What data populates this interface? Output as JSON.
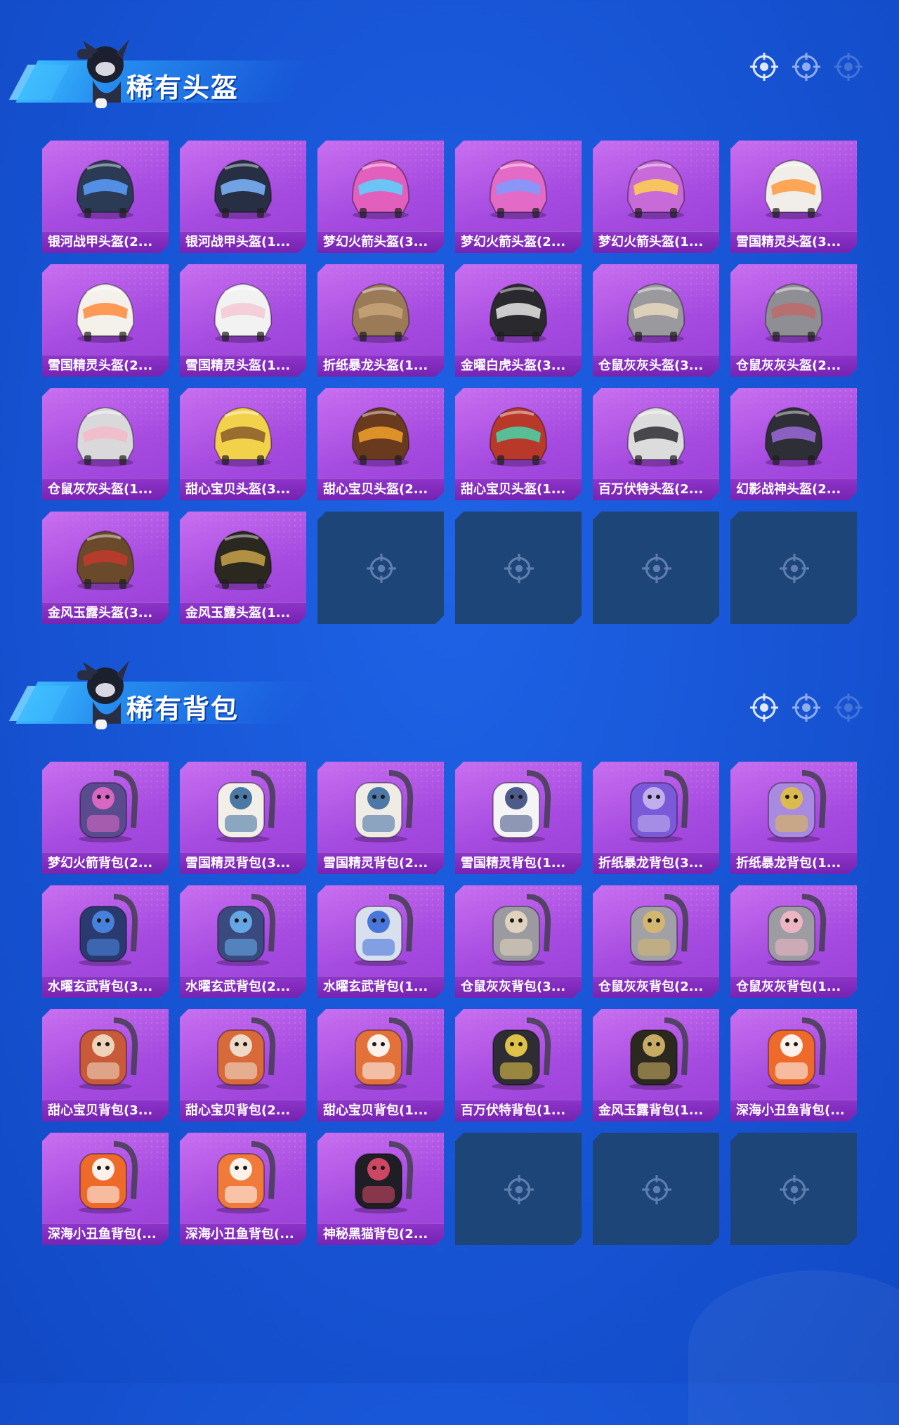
{
  "sections": [
    {
      "title": "稀有头盔",
      "items": [
        {
          "label": "银河战甲头盔(2...",
          "icon": "helmet-icon",
          "color": "#2b3a55",
          "accent": "#5aa0ff"
        },
        {
          "label": "银河战甲头盔(1...",
          "icon": "helmet-icon",
          "color": "#262f44",
          "accent": "#7fb6ff"
        },
        {
          "label": "梦幻火箭头盔(3...",
          "icon": "helmet-icon",
          "color": "#e25fbd",
          "accent": "#57d6ff"
        },
        {
          "label": "梦幻火箭头盔(2...",
          "icon": "helmet-icon",
          "color": "#e46ac8",
          "accent": "#7a9cff"
        },
        {
          "label": "梦幻火箭头盔(1...",
          "icon": "helmet-icon",
          "color": "#c86ad8",
          "accent": "#ffd34a"
        },
        {
          "label": "雪国精灵头盔(3...",
          "icon": "helmet-icon",
          "color": "#f1ede8",
          "accent": "#ff9a3c"
        },
        {
          "label": "雪国精灵头盔(2...",
          "icon": "helmet-icon",
          "color": "#f4f0ea",
          "accent": "#ff8a3c"
        },
        {
          "label": "雪国精灵头盔(1...",
          "icon": "helmet-icon",
          "color": "#f2f2f2",
          "accent": "#f4c9d6"
        },
        {
          "label": "折纸暴龙头盔(1...",
          "icon": "helmet-icon",
          "color": "#9b7a58",
          "accent": "#c9a57a"
        },
        {
          "label": "金曜白虎头盔(3...",
          "icon": "helmet-icon",
          "color": "#2a2a2e",
          "accent": "#e8e8e8"
        },
        {
          "label": "仓鼠灰灰头盔(3...",
          "icon": "helmet-icon",
          "color": "#9a9a9e",
          "accent": "#e8d9c0"
        },
        {
          "label": "仓鼠灰灰头盔(2...",
          "icon": "helmet-icon",
          "color": "#8e8e94",
          "accent": "#c06a6a"
        },
        {
          "label": "仓鼠灰灰头盔(1...",
          "icon": "helmet-icon",
          "color": "#d9d9dc",
          "accent": "#f4b8c8"
        },
        {
          "label": "甜心宝贝头盔(3...",
          "icon": "helmet-icon",
          "color": "#f2d24a",
          "accent": "#8a5a2a"
        },
        {
          "label": "甜心宝贝头盔(2...",
          "icon": "helmet-icon",
          "color": "#6a3a1e",
          "accent": "#f0a22a"
        },
        {
          "label": "甜心宝贝头盔(1...",
          "icon": "helmet-icon",
          "color": "#b8392a",
          "accent": "#45d6a8"
        },
        {
          "label": "百万伏特头盔(2...",
          "icon": "helmet-icon",
          "color": "#dcdcdc",
          "accent": "#2d2d33"
        },
        {
          "label": "幻影战神头盔(2...",
          "icon": "helmet-icon",
          "color": "#2e2e36",
          "accent": "#9a6ad8"
        },
        {
          "label": "金风玉露头盔(3...",
          "icon": "helmet-icon",
          "color": "#6a4a2a",
          "accent": "#c23a2a"
        },
        {
          "label": "金风玉露头盔(1...",
          "icon": "helmet-icon",
          "color": "#2b2820",
          "accent": "#c9a24a"
        },
        {
          "empty": true
        },
        {
          "empty": true
        },
        {
          "empty": true
        },
        {
          "empty": true
        }
      ]
    },
    {
      "title": "稀有背包",
      "items": [
        {
          "label": "梦幻火箭背包(2...",
          "icon": "backpack-icon",
          "color": "#5a4a8e",
          "accent": "#e46ac8"
        },
        {
          "label": "雪国精灵背包(3...",
          "icon": "backpack-icon",
          "color": "#f2efe8",
          "accent": "#3a6a9e"
        },
        {
          "label": "雪国精灵背包(2...",
          "icon": "backpack-icon",
          "color": "#efece6",
          "accent": "#3a6a9e"
        },
        {
          "label": "雪国精灵背包(1...",
          "icon": "backpack-icon",
          "color": "#f4f4f4",
          "accent": "#3a4a7e"
        },
        {
          "label": "折纸暴龙背包(3...",
          "icon": "backpack-icon",
          "color": "#7a5ad8",
          "accent": "#c9b8f0"
        },
        {
          "label": "折纸暴龙背包(1...",
          "icon": "backpack-icon",
          "color": "#a88ae0",
          "accent": "#e0c040"
        },
        {
          "label": "水曜玄武背包(3...",
          "icon": "backpack-icon",
          "color": "#2a3a6e",
          "accent": "#4a8ae8"
        },
        {
          "label": "水曜玄武背包(2...",
          "icon": "backpack-icon",
          "color": "#3a4a7e",
          "accent": "#6ab0f0"
        },
        {
          "label": "水曜玄武背包(1...",
          "icon": "backpack-icon",
          "color": "#d8e0ee",
          "accent": "#3a6ad8"
        },
        {
          "label": "仓鼠灰灰背包(3...",
          "icon": "backpack-icon",
          "color": "#9a9aa0",
          "accent": "#e8d9c0"
        },
        {
          "label": "仓鼠灰灰背包(2...",
          "icon": "backpack-icon",
          "color": "#a0a0a6",
          "accent": "#d8b86a"
        },
        {
          "label": "仓鼠灰灰背包(1...",
          "icon": "backpack-icon",
          "color": "#9c9ca2",
          "accent": "#f4b8c8"
        },
        {
          "label": "甜心宝贝背包(3...",
          "icon": "backpack-icon",
          "color": "#c85a3a",
          "accent": "#f2e0c8"
        },
        {
          "label": "甜心宝贝背包(2...",
          "icon": "backpack-icon",
          "color": "#d86a3a",
          "accent": "#f2e6d8"
        },
        {
          "label": "甜心宝贝背包(1...",
          "icon": "backpack-icon",
          "color": "#e2723a",
          "accent": "#ffffff"
        },
        {
          "label": "百万伏特背包(1...",
          "icon": "backpack-icon",
          "color": "#2d2d33",
          "accent": "#f2d24a"
        },
        {
          "label": "金风玉露背包(1...",
          "icon": "backpack-icon",
          "color": "#2b2820",
          "accent": "#d8b86a"
        },
        {
          "label": "深海小丑鱼背包(...",
          "icon": "backpack-icon",
          "color": "#ee6a2a",
          "accent": "#ffffff"
        },
        {
          "label": "深海小丑鱼背包(...",
          "icon": "backpack-icon",
          "color": "#ee6a2a",
          "accent": "#ffffff"
        },
        {
          "label": "深海小丑鱼背包(...",
          "icon": "backpack-icon",
          "color": "#f07a3a",
          "accent": "#ffffff"
        },
        {
          "label": "神秘黑猫背包(2...",
          "icon": "backpack-icon",
          "color": "#1e1e24",
          "accent": "#e04a6a"
        },
        {
          "empty": true
        },
        {
          "empty": true
        },
        {
          "empty": true
        }
      ]
    }
  ]
}
